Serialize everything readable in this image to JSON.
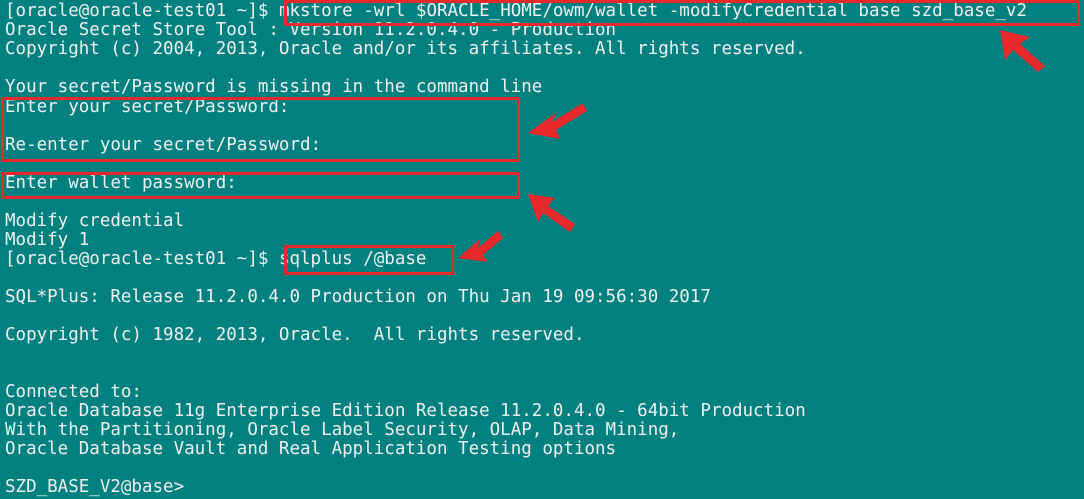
{
  "terminal": {
    "lines": [
      {
        "prompt": "[oracle@oracle-test01 ~]$ ",
        "command": "mkstore -wrl $ORACLE_HOME/owm/wallet -modifyCredential base szd_base_v2"
      },
      {
        "text": "Oracle Secret Store Tool : Version 11.2.0.4.0 - Production"
      },
      {
        "text": "Copyright (c) 2004, 2013, Oracle and/or its affiliates. All rights reserved."
      },
      {
        "text": ""
      },
      {
        "text": "Your secret/Password is missing in the command line"
      },
      {
        "text": "Enter your secret/Password:"
      },
      {
        "text": ""
      },
      {
        "text": "Re-enter your secret/Password:"
      },
      {
        "text": ""
      },
      {
        "text": "Enter wallet password:"
      },
      {
        "text": ""
      },
      {
        "text": "Modify credential"
      },
      {
        "text": "Modify 1"
      },
      {
        "prompt": "[oracle@oracle-test01 ~]$ ",
        "command": "sqlplus /@base"
      },
      {
        "text": ""
      },
      {
        "text": "SQL*Plus: Release 11.2.0.4.0 Production on Thu Jan 19 09:56:30 2017"
      },
      {
        "text": ""
      },
      {
        "text": "Copyright (c) 1982, 2013, Oracle.  All rights reserved."
      },
      {
        "text": ""
      },
      {
        "text": ""
      },
      {
        "text": "Connected to:"
      },
      {
        "text": "Oracle Database 11g Enterprise Edition Release 11.2.0.4.0 - 64bit Production"
      },
      {
        "text": "With the Partitioning, Oracle Label Security, OLAP, Data Mining,"
      },
      {
        "text": "Oracle Database Vault and Real Application Testing options"
      },
      {
        "text": ""
      },
      {
        "text": "SZD_BASE_V2@base> "
      }
    ]
  },
  "colors": {
    "background": "#00807F",
    "text": "#F0F0F0",
    "highlight": "#E8292B"
  }
}
